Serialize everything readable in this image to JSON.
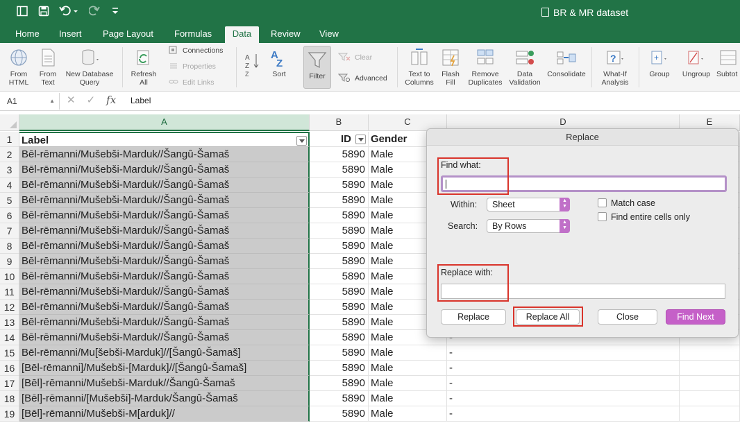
{
  "window": {
    "title": "BR & MR dataset",
    "accent_color": "#217346",
    "quick_access": [
      "sidebar-icon",
      "save-icon",
      "undo-icon",
      "redo-icon",
      "customize-icon"
    ]
  },
  "ribbon_tabs": [
    {
      "label": "Home"
    },
    {
      "label": "Insert"
    },
    {
      "label": "Page Layout"
    },
    {
      "label": "Formulas"
    },
    {
      "label": "Data",
      "active": true
    },
    {
      "label": "Review"
    },
    {
      "label": "View"
    }
  ],
  "ribbon": {
    "from_html": [
      "From",
      "HTML"
    ],
    "from_text": [
      "From",
      "Text"
    ],
    "new_db_query": [
      "New Database",
      "Query"
    ],
    "refresh_all": [
      "Refresh",
      "All"
    ],
    "connections": "Connections",
    "properties": "Properties",
    "edit_links": "Edit Links",
    "sort": "Sort",
    "filter": "Filter",
    "clear": "Clear",
    "advanced": "Advanced",
    "text_to_columns": [
      "Text to",
      "Columns"
    ],
    "flash_fill": [
      "Flash",
      "Fill"
    ],
    "remove_duplicates": [
      "Remove",
      "Duplicates"
    ],
    "data_validation": [
      "Data",
      "Validation"
    ],
    "consolidate": "Consolidate",
    "what_if": [
      "What-If",
      "Analysis"
    ],
    "group": "Group",
    "ungroup": "Ungroup",
    "subtotal": "Subtot"
  },
  "formula_bar": {
    "cell_ref": "A1",
    "content": "Label"
  },
  "columns": [
    "A",
    "B",
    "C",
    "D",
    "E"
  ],
  "header_row": {
    "num": "1",
    "A": "Label",
    "B": "ID",
    "C": "Gender"
  },
  "rows": [
    {
      "num": "2",
      "A": "Bēl-rēmanni/Mušebši-Marduk//Šangû-Šamaš",
      "B": "5890",
      "C": "Male",
      "D": ""
    },
    {
      "num": "3",
      "A": "Bēl-rēmanni/Mušebši-Marduk//Šangû-Šamaš",
      "B": "5890",
      "C": "Male",
      "D": ""
    },
    {
      "num": "4",
      "A": "Bēl-rēmanni/Mušebši-Marduk//Šangû-Šamaš",
      "B": "5890",
      "C": "Male",
      "D": ""
    },
    {
      "num": "5",
      "A": "Bēl-rēmanni/Mušebši-Marduk//Šangû-Šamaš",
      "B": "5890",
      "C": "Male",
      "D": ""
    },
    {
      "num": "6",
      "A": "Bēl-rēmanni/Mušebši-Marduk//Šangû-Šamaš",
      "B": "5890",
      "C": "Male",
      "D": ""
    },
    {
      "num": "7",
      "A": "Bēl-rēmanni/Mušebši-Marduk//Šangû-Šamaš",
      "B": "5890",
      "C": "Male",
      "D": ""
    },
    {
      "num": "8",
      "A": "Bēl-rēmanni/Mušebši-Marduk//Šangû-Šamaš",
      "B": "5890",
      "C": "Male",
      "D": ""
    },
    {
      "num": "9",
      "A": "Bēl-rēmanni/Mušebši-Marduk//Šangû-Šamaš",
      "B": "5890",
      "C": "Male",
      "D": ""
    },
    {
      "num": "10",
      "A": "Bēl-rēmanni/Mušebši-Marduk//Šangû-Šamaš",
      "B": "5890",
      "C": "Male",
      "D": ""
    },
    {
      "num": "11",
      "A": "Bēl-rēmanni/Mušebši-Marduk//Šangû-Šamaš",
      "B": "5890",
      "C": "Male",
      "D": ""
    },
    {
      "num": "12",
      "A": "Bēl-rēmanni/Mušebši-Marduk//Šangû-Šamaš",
      "B": "5890",
      "C": "Male",
      "D": ""
    },
    {
      "num": "13",
      "A": "Bēl-rēmanni/Mušebši-Marduk//Šangû-Šamaš",
      "B": "5890",
      "C": "Male",
      "D": ""
    },
    {
      "num": "14",
      "A": "Bēl-rēmanni/Mušebši-Marduk//Šangû-Šamaš",
      "B": "5890",
      "C": "Male",
      "D": "-"
    },
    {
      "num": "15",
      "A": "Bēl-rēmanni/Mu[šebši-Marduk]//[Šangû-Šamaš]",
      "B": "5890",
      "C": "Male",
      "D": "-"
    },
    {
      "num": "16",
      "A": "[Bēl-rēmanni]/Mušebši-[Marduk]//[Šangû-Šamaš]",
      "B": "5890",
      "C": "Male",
      "D": "-"
    },
    {
      "num": "17",
      "A": "[Bēl]-rēmanni/Mušebši-Marduk//Šangû-Šamaš",
      "B": "5890",
      "C": "Male",
      "D": "-"
    },
    {
      "num": "18",
      "A": "[Bēl]-rēmanni/[Mušebši]-Marduk/Šangû-Šamaš",
      "B": "5890",
      "C": "Male",
      "D": "-"
    },
    {
      "num": "19",
      "A": "[Bēl]-rēmanni/Mušebši-M[arduk]//",
      "B": "5890",
      "C": "Male",
      "D": "-"
    }
  ],
  "dialog": {
    "title": "Replace",
    "find_label": "Find what:",
    "find_value": "",
    "within_label": "Within:",
    "within_value": "Sheet",
    "search_label": "Search:",
    "search_value": "By Rows",
    "match_case": "Match case",
    "entire_cells": "Find entire cells only",
    "replace_label": "Replace with:",
    "replace_value": "",
    "btn_replace": "Replace",
    "btn_replace_all": "Replace All",
    "btn_close": "Close",
    "btn_find_next": "Find Next",
    "highlight_color": "#d9342b",
    "primary_color": "#c560c8"
  }
}
